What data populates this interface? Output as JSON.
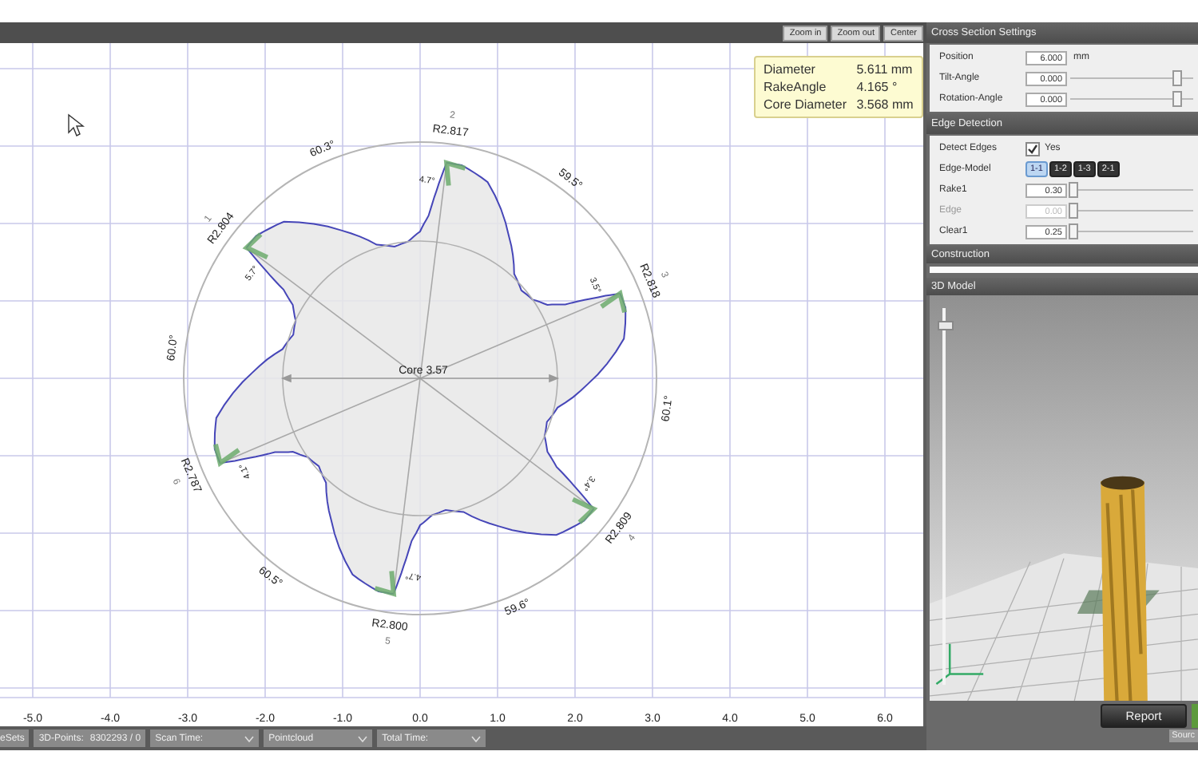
{
  "toolbar": {
    "buttons": [
      "Zoom in",
      "Zoom out",
      "Center"
    ]
  },
  "info": [
    {
      "label": "Diameter",
      "value": "5.611 mm"
    },
    {
      "label": "RakeAngle",
      "value": "4.165 °"
    },
    {
      "label": "Core Diameter",
      "value": "3.568 mm"
    }
  ],
  "profile": {
    "teeth": [
      {
        "number": "1",
        "radius": "R2.804",
        "rake": "5.7°"
      },
      {
        "number": "2",
        "radius": "R2.817",
        "rake": "4.7°"
      },
      {
        "number": "3",
        "radius": "R2.818",
        "rake": "3.5°"
      },
      {
        "number": "4",
        "radius": "R2.809",
        "rake": "3.4°"
      },
      {
        "number": "5",
        "radius": "R2.800",
        "rake": "4.7°"
      },
      {
        "number": "6",
        "radius": "R2.787",
        "rake": "4.1°"
      }
    ],
    "pitch_angles": [
      "60.3°",
      "59.5°",
      "60.1°",
      "59.6°",
      "60.5°",
      "60.0°"
    ],
    "core_label": "Core 3.57"
  },
  "x_ticks": [
    "-5.0",
    "-4.0",
    "-3.0",
    "-2.0",
    "-1.0",
    "0.0",
    "1.0",
    "2.0",
    "3.0",
    "4.0",
    "5.0",
    "6.0"
  ],
  "status_bar": [
    {
      "kind": "text",
      "label": "eSets"
    },
    {
      "kind": "text",
      "label": "3D-Points:",
      "value": "8302293 / 0"
    },
    {
      "kind": "dropdown",
      "label": "Scan Time:"
    },
    {
      "kind": "dropdown",
      "label": "Pointcloud"
    },
    {
      "kind": "dropdown",
      "label": "Total Time:"
    }
  ],
  "cross_section": {
    "title": "Cross Section Settings",
    "rows": [
      {
        "kind": "field",
        "label": "Position",
        "value": "6.000",
        "unit": "mm"
      },
      {
        "kind": "slider",
        "label": "Tilt-Angle",
        "value": "0.000",
        "level": 0.85
      },
      {
        "kind": "slider",
        "label": "Rotation-Angle",
        "value": "0.000",
        "level": 0.85
      }
    ]
  },
  "edge_detection": {
    "title": "Edge Detection",
    "rows": [
      {
        "kind": "checkbox",
        "label": "Detect Edges",
        "checked": true,
        "text": "Yes"
      },
      {
        "kind": "models",
        "label": "Edge-Model",
        "options": [
          {
            "label": "1-1",
            "selected": true
          },
          {
            "label": "1-2",
            "selected": false
          },
          {
            "label": "1-3",
            "selected": false
          },
          {
            "label": "2-1",
            "selected": false
          }
        ]
      },
      {
        "kind": "slider",
        "label": "Rake1",
        "value": "0.30",
        "level": 0,
        "disabled": false
      },
      {
        "kind": "slider",
        "label": "Edge",
        "value": "0.00",
        "level": 0,
        "disabled": true
      },
      {
        "kind": "slider",
        "label": "Clear1",
        "value": "0.25",
        "level": 0,
        "disabled": false
      }
    ]
  },
  "construction": {
    "title": "Construction"
  },
  "model_view": {
    "title": "3D Model",
    "zoom_slider": {
      "level": 0.95
    }
  },
  "actions": {
    "report": "Report",
    "source": "Sourc"
  }
}
